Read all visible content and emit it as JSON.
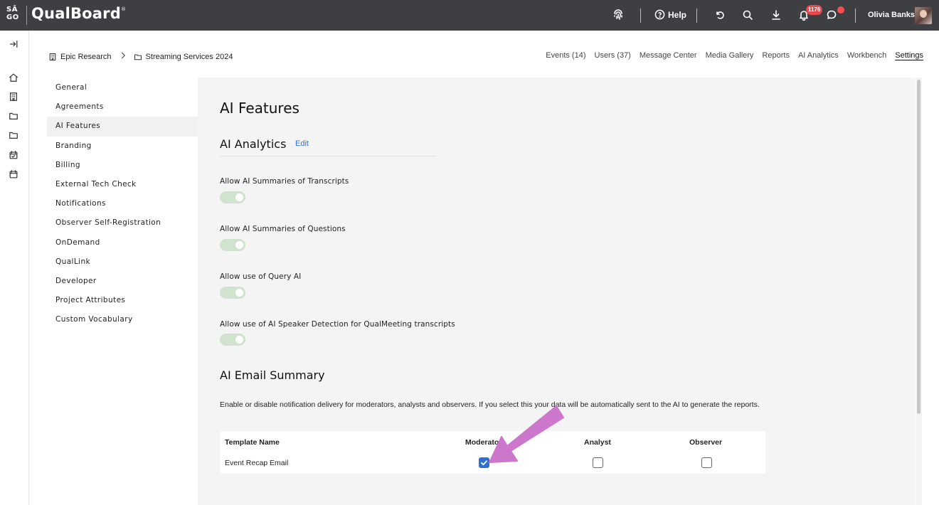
{
  "brand": {
    "mark": "SĀ\nGO",
    "name": "QualBoard",
    "trademark": "®"
  },
  "topbar": {
    "help_label": "Help",
    "notification_count": "1176",
    "user_name": "Olivia Banks"
  },
  "breadcrumb": {
    "org": "Epic Research",
    "project": "Streaming Services 2024"
  },
  "topnav": {
    "tabs": [
      "Events (14)",
      "Users (37)",
      "Message Center",
      "Media Gallery",
      "Reports",
      "AI Analytics",
      "Workbench",
      "Settings"
    ],
    "active": "Settings"
  },
  "sidenav": {
    "items": [
      "General",
      "Agreements",
      "AI Features",
      "Branding",
      "Billing",
      "External Tech Check",
      "Notifications",
      "Observer Self-Registration",
      "OnDemand",
      "QualLink",
      "Developer",
      "Project Attributes",
      "Custom Vocabulary"
    ],
    "active": "AI Features"
  },
  "content": {
    "title": "AI Features",
    "analytics_heading": "AI Analytics",
    "edit_label": "Edit",
    "settings": [
      {
        "label": "Allow AI Summaries of Transcripts",
        "enabled": true
      },
      {
        "label": "Allow AI Summaries of Questions",
        "enabled": true
      },
      {
        "label": "Allow use of Query AI",
        "enabled": true
      },
      {
        "label": "Allow use of AI Speaker Detection for QualMeeting transcripts",
        "enabled": true
      }
    ],
    "email_heading": "AI Email Summary",
    "email_description": "Enable or disable notification delivery for moderators, analysts and observers. If you select this your data will be automatically sent to the AI to generate the reports.",
    "table": {
      "headers": [
        "Template Name",
        "Moderator",
        "Analyst",
        "Observer"
      ],
      "rows": [
        {
          "name": "Event Recap Email",
          "moderator": true,
          "analyst": false,
          "observer": false
        }
      ]
    }
  },
  "colors": {
    "topbar": "#3d3f43",
    "accent": "#2f6fd1",
    "toggle_on": "#cfe3cf",
    "annotation_arrow": "#cc77cc",
    "badge": "#e5484d"
  }
}
